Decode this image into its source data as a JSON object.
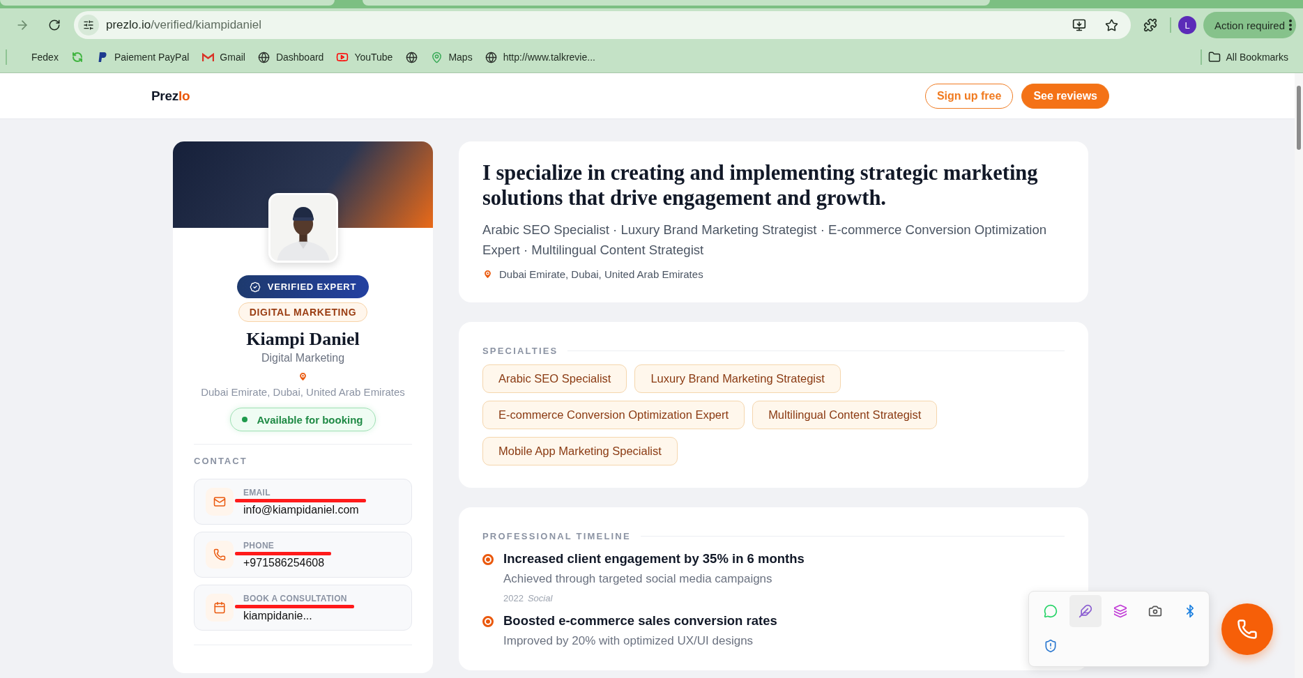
{
  "browser": {
    "url_host": "prezlo.io",
    "url_path": "/verified/kiampidaniel",
    "profile_initial": "L",
    "action_button": "Action required",
    "bookmarks": [
      {
        "kind": "plain",
        "label": "Fedex"
      },
      {
        "kind": "app"
      },
      {
        "kind": "paypal",
        "label": "Paiement PayPal"
      },
      {
        "kind": "gmail",
        "label": "Gmail"
      },
      {
        "kind": "globe",
        "label": "Dashboard"
      },
      {
        "kind": "video",
        "label": "YouTube"
      },
      {
        "kind": "globe"
      },
      {
        "kind": "maps",
        "label": "Maps"
      },
      {
        "kind": "globe",
        "label": "http://www.talkrevie..."
      }
    ],
    "all_bookmarks": "All Bookmarks"
  },
  "header": {
    "logo_main": "Prez",
    "logo_accent": "lo",
    "buttons": [
      {
        "kind": "outline",
        "label": "Sign up free"
      },
      {
        "kind": "solid",
        "label": "See reviews"
      }
    ]
  },
  "profile": {
    "badge": "VERIFIED EXPERT",
    "category": "DIGITAL MARKETING",
    "name": "Kiampi Daniel",
    "title": "Digital Marketing",
    "location": "Dubai Emirate, Dubai, United Arab Emirates",
    "availability": {
      "label": "Available for booking",
      "available": true
    },
    "contact_heading": "CONTACT",
    "contacts": [
      {
        "kind": "email",
        "label": "EMAIL",
        "value": "info@kiampidaniel.com",
        "redacted": true
      },
      {
        "kind": "phone",
        "label": "PHONE",
        "value": "+971586254608",
        "redacted": true
      },
      {
        "kind": "calendar",
        "label": "BOOK A CONSULTATION",
        "value": "kiampidanie...",
        "redacted": true
      }
    ]
  },
  "summary": {
    "headline": "I specialize in creating and implementing strategic marketing solutions that drive engagement and growth.",
    "roles": "Arabic SEO Specialist · Luxury Brand Marketing Strategist · E-commerce Conversion Optimization Expert · Multilingual Content Strategist",
    "location": "Dubai Emirate, Dubai, United Arab Emirates"
  },
  "specialties": {
    "heading": "SPECIALTIES",
    "tags": [
      "Arabic SEO Specialist",
      "Luxury Brand Marketing Strategist",
      "E-commerce Conversion Optimization Expert",
      "Multilingual Content Strategist",
      "Mobile App Marketing Specialist"
    ]
  },
  "timeline": {
    "heading": "PROFESSIONAL TIMELINE",
    "items": [
      {
        "title": "Increased client engagement by 35% in 6 months",
        "description": "Achieved through targeted social media campaigns",
        "year": "2022",
        "category": "Social"
      },
      {
        "title": "Boosted e-commerce sales conversion rates",
        "description": "Improved by 20% with optimized UX/UI designs"
      }
    ]
  },
  "tray": {
    "icons": [
      {
        "kind": "chat",
        "selected": false
      },
      {
        "kind": "feather",
        "selected": true
      },
      {
        "kind": "suite",
        "selected": false
      },
      {
        "kind": "camera",
        "selected": false
      },
      {
        "kind": "bluetooth",
        "selected": false
      },
      {
        "kind": "shield",
        "selected": false
      }
    ]
  }
}
